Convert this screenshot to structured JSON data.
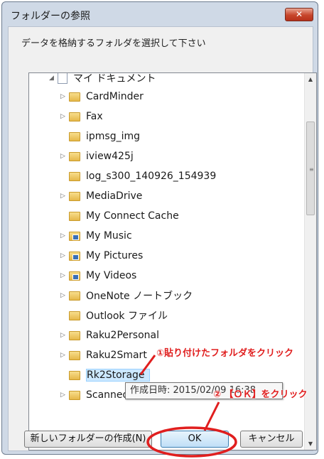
{
  "window": {
    "title": "フォルダーの参照",
    "close_label": "✕"
  },
  "description": "データを格納するフォルダを選択して下さい",
  "tree": {
    "root": "マイ ドキュメント",
    "items": [
      {
        "label": "CardMinder",
        "expander": "▷",
        "icon": "folder-icon"
      },
      {
        "label": "Fax",
        "expander": "▷",
        "icon": "folder-icon"
      },
      {
        "label": "ipmsg_img",
        "expander": "",
        "icon": "folder-icon"
      },
      {
        "label": "iview425j",
        "expander": "▷",
        "icon": "folder-icon"
      },
      {
        "label": "log_s300_140926_154939",
        "expander": "",
        "icon": "folder-icon"
      },
      {
        "label": "MediaDrive",
        "expander": "▷",
        "icon": "folder-icon"
      },
      {
        "label": "My Connect Cache",
        "expander": "",
        "icon": "folder-icon"
      },
      {
        "label": "My Music",
        "expander": "▷",
        "icon": "music-folder-icon"
      },
      {
        "label": "My Pictures",
        "expander": "▷",
        "icon": "pictures-folder-icon"
      },
      {
        "label": "My Videos",
        "expander": "▷",
        "icon": "videos-folder-icon"
      },
      {
        "label": "OneNote ノートブック",
        "expander": "▷",
        "icon": "folder-icon"
      },
      {
        "label": "Outlook ファイル",
        "expander": "",
        "icon": "folder-icon"
      },
      {
        "label": "Raku2Personal",
        "expander": "▷",
        "icon": "folder-icon"
      },
      {
        "label": "Raku2Smart",
        "expander": "▷",
        "icon": "folder-icon"
      },
      {
        "label": "Rk2Storage",
        "expander": "",
        "icon": "folder-icon",
        "selected": true
      },
      {
        "label": "Scanned Documents",
        "expander": "▷",
        "icon": "folder-icon"
      }
    ]
  },
  "tooltip": "作成日時: 2015/02/09 16:38",
  "buttons": {
    "new_folder": "新しいフォルダーの作成(N)",
    "ok": "OK",
    "cancel": "キャンセル"
  },
  "annotations": {
    "step1": "①貼り付けたフォルダをクリック",
    "step2": "② 【ＯＫ】をクリック",
    "color": "#e01e1e"
  }
}
